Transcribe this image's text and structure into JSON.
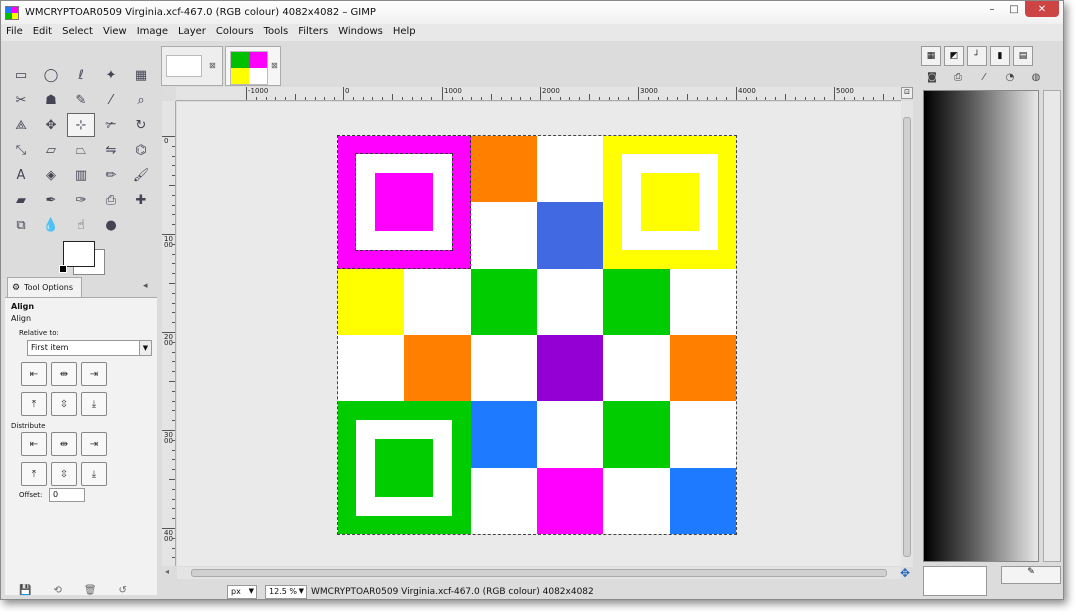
{
  "window": {
    "title": "WMCRYPTOAR0509 Virginia.xcf-467.0 (RGB colour) 4082x4082 – GIMP",
    "controls": [
      "–",
      "□",
      "✕"
    ]
  },
  "menu": [
    {
      "label": "File"
    },
    {
      "label": "Edit"
    },
    {
      "label": "Select"
    },
    {
      "label": "View"
    },
    {
      "label": "Image"
    },
    {
      "label": "Layer"
    },
    {
      "label": "Colours"
    },
    {
      "label": "Tools"
    },
    {
      "label": "Filters"
    },
    {
      "label": "Windows"
    },
    {
      "label": "Help"
    }
  ],
  "toolbox": {
    "tools": [
      {
        "name": "rect-select-tool-icon",
        "glyph": "▭"
      },
      {
        "name": "ellipse-select-tool-icon",
        "glyph": "◯"
      },
      {
        "name": "free-select-tool-icon",
        "glyph": "ℓ"
      },
      {
        "name": "fuzzy-select-tool-icon",
        "glyph": "✦"
      },
      {
        "name": "color-select-tool-icon",
        "glyph": "▦"
      },
      {
        "name": "scissors-select-tool-icon",
        "glyph": "✂"
      },
      {
        "name": "foreground-select-tool-icon",
        "glyph": "☗"
      },
      {
        "name": "paths-tool-icon",
        "glyph": "✎"
      },
      {
        "name": "color-picker-tool-icon",
        "glyph": "⁄"
      },
      {
        "name": "zoom-tool-icon",
        "glyph": "⌕"
      },
      {
        "name": "measure-tool-icon",
        "glyph": "⟁"
      },
      {
        "name": "move-tool-icon",
        "glyph": "✥"
      },
      {
        "name": "align-tool-icon",
        "glyph": "⊹"
      },
      {
        "name": "crop-tool-icon",
        "glyph": "✃"
      },
      {
        "name": "rotate-tool-icon",
        "glyph": "↻"
      },
      {
        "name": "scale-tool-icon",
        "glyph": "⤡"
      },
      {
        "name": "shear-tool-icon",
        "glyph": "▱"
      },
      {
        "name": "perspective-tool-icon",
        "glyph": "⏢"
      },
      {
        "name": "flip-tool-icon",
        "glyph": "⇋"
      },
      {
        "name": "cage-transform-tool-icon",
        "glyph": "⌬"
      },
      {
        "name": "text-tool-icon",
        "glyph": "A"
      },
      {
        "name": "bucket-fill-tool-icon",
        "glyph": "◈"
      },
      {
        "name": "blend-tool-icon",
        "glyph": "▥"
      },
      {
        "name": "pencil-tool-icon",
        "glyph": "✏"
      },
      {
        "name": "paintbrush-tool-icon",
        "glyph": "🖌"
      },
      {
        "name": "eraser-tool-icon",
        "glyph": "▰"
      },
      {
        "name": "airbrush-tool-icon",
        "glyph": "✒"
      },
      {
        "name": "ink-tool-icon",
        "glyph": "✑"
      },
      {
        "name": "clone-tool-icon",
        "glyph": "⎙"
      },
      {
        "name": "heal-tool-icon",
        "glyph": "✚"
      },
      {
        "name": "perspective-clone-tool-icon",
        "glyph": "⧉"
      },
      {
        "name": "blur-tool-icon",
        "glyph": "💧"
      },
      {
        "name": "smudge-tool-icon",
        "glyph": "☝"
      },
      {
        "name": "dodge-burn-tool-icon",
        "glyph": "●"
      }
    ],
    "tool_options_tab": "Tool Options",
    "options": {
      "title": "Align",
      "subtitle": "Align",
      "relative_to_label": "Relative to:",
      "relative_to_value": "First item",
      "distribute_label": "Distribute",
      "offset_label": "Offset:",
      "offset_value": "0"
    }
  },
  "image_tabs": [
    {
      "label": ""
    },
    {
      "label": ""
    }
  ],
  "rulers": {
    "horizontal": [
      "-1000",
      "0",
      "1000",
      "2000",
      "3000",
      "4000",
      "5000"
    ],
    "vertical": [
      "0",
      "1000",
      "2000",
      "3000",
      "4000"
    ]
  },
  "canvas": {
    "grid": [
      [
        "#ff00ff",
        "#ff00ff",
        "#ff8000",
        "#ffffff",
        "#ffff00",
        "#ffff00"
      ],
      [
        "#ff00ff",
        "#ff00ff",
        "#ffffff",
        "#4169e1",
        "#ffff00",
        "#ffff00"
      ],
      [
        "#ffff00",
        "#ffffff",
        "#00cc00",
        "#ffffff",
        "#00cc00",
        "#ffffff"
      ],
      [
        "#ffffff",
        "#ff8000",
        "#ffffff",
        "#9400d3",
        "#ffffff",
        "#ff8000"
      ],
      [
        "#00cc00",
        "#00cc00",
        "#1e7bff",
        "#ffffff",
        "#00cc00",
        "#ffffff"
      ],
      [
        "#00cc00",
        "#00cc00",
        "#ffffff",
        "#ff00ff",
        "#ffffff",
        "#1e7bff"
      ]
    ],
    "finders": {
      "top_left": "#ff00ff",
      "top_right": "#ffff00",
      "bottom_left": "#00cc00"
    }
  },
  "statusbar": {
    "unit": "px",
    "zoom": "12.5 %",
    "info": "WMCRYPTOAR0509 Virginia.xcf-467.0 (RGB colour) 4082x4082"
  },
  "colors": {
    "window_bg": "#dcdcdc",
    "canvas_bg": "#eaeaea",
    "accent": "#2266bb"
  }
}
